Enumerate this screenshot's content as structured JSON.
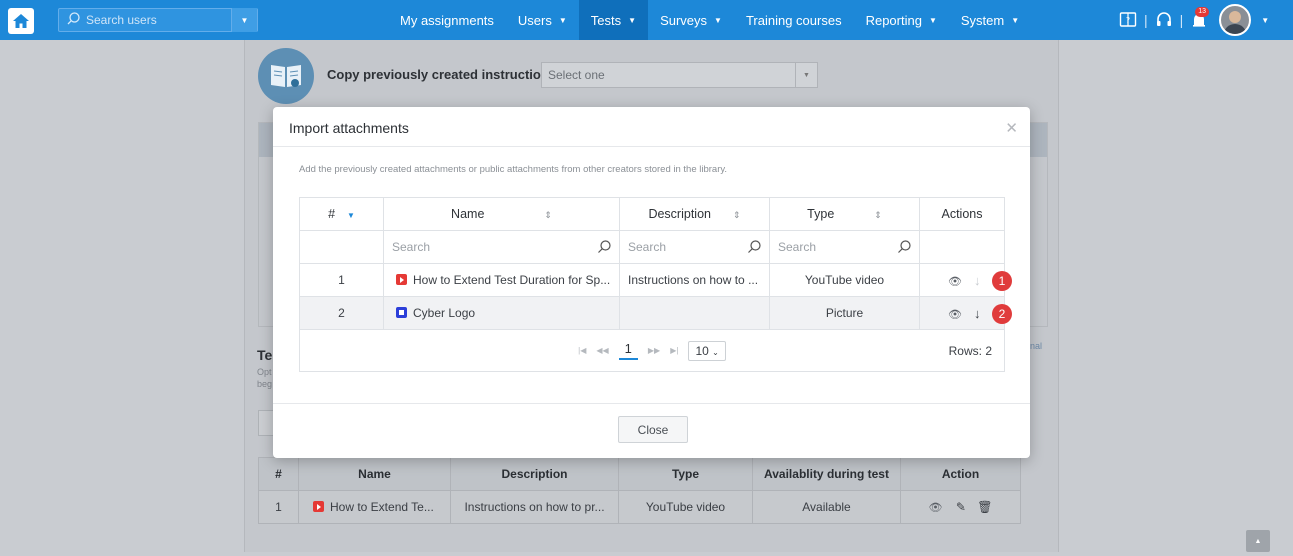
{
  "topbar": {
    "search_placeholder": "Search users",
    "nav": [
      {
        "label": "My assignments",
        "caret": false,
        "active": false
      },
      {
        "label": "Users",
        "caret": true,
        "active": false
      },
      {
        "label": "Tests",
        "caret": true,
        "active": true
      },
      {
        "label": "Surveys",
        "caret": true,
        "active": false
      },
      {
        "label": "Training courses",
        "caret": false,
        "active": false
      },
      {
        "label": "Reporting",
        "caret": true,
        "active": false
      },
      {
        "label": "System",
        "caret": true,
        "active": false
      }
    ],
    "notification_count": "13"
  },
  "background": {
    "copy_label": "Copy previously created instructions:",
    "copy_select_value": "Select one",
    "section_title_partial": "Te",
    "section_desc_line1": "Opt",
    "section_desc_line2": "beg",
    "optional_partial": "nal",
    "table": {
      "headers": [
        "#",
        "Name",
        "Description",
        "Type",
        "Availablity during test",
        "Action"
      ],
      "rows": [
        {
          "num": "1",
          "name": "How to Extend Te...",
          "description": "Instructions on how to pr...",
          "type": "YouTube video",
          "availability": "Available"
        }
      ]
    }
  },
  "modal": {
    "title": "Import attachments",
    "description": "Add the previously created attachments or public attachments from other creators stored in the library.",
    "columns": {
      "num": "#",
      "name": "Name",
      "description": "Description",
      "type": "Type",
      "actions": "Actions"
    },
    "search_placeholder": "Search",
    "rows": [
      {
        "num": "1",
        "icon": "youtube-icon",
        "name": "How to Extend Test Duration for Sp...",
        "description": "Instructions on how to ...",
        "type": "YouTube video",
        "badge": "1"
      },
      {
        "num": "2",
        "icon": "picture-icon",
        "name": "Cyber Logo",
        "description": "",
        "type": "Picture",
        "badge": "2"
      }
    ],
    "pager": {
      "current_page": "1",
      "page_size": "10"
    },
    "rows_label": "Rows: 2",
    "close_label": "Close"
  },
  "colors": {
    "topbar": "#1d88d8",
    "active_nav": "#0f6fbb",
    "badge": "#e03b3b",
    "youtube": "#e53935",
    "picture": "#2c3fd9"
  }
}
